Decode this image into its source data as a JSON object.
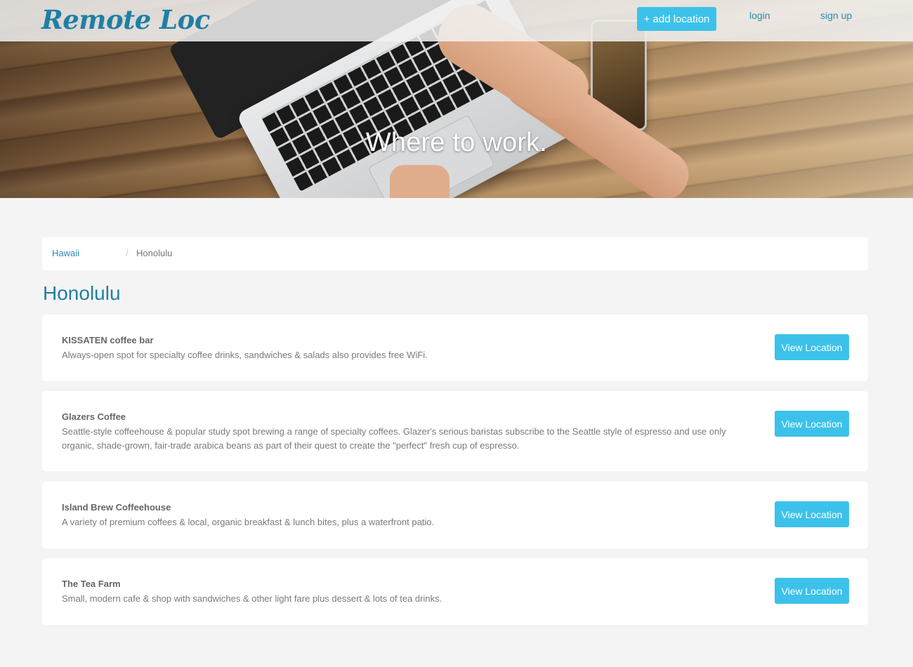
{
  "header": {
    "brand": "Remote Loc",
    "add_location_label": "+ add location",
    "login_label": "login",
    "signup_label": "sign up"
  },
  "hero": {
    "tagline": "Where to work."
  },
  "breadcrumb": {
    "parent": "Hawaii",
    "separator": "/",
    "current": "Honolulu"
  },
  "page": {
    "title": "Honolulu"
  },
  "locations": [
    {
      "name": "KISSATEN coffee bar",
      "description": "Always-open spot for specialty coffee drinks, sandwiches & salads also provides free WiFi.",
      "button_label": "View Location"
    },
    {
      "name": "Glazers Coffee",
      "description": "Seattle-style coffeehouse & popular study spot brewing a range of specialty coffees. Glazer's serious baristas subscribe to the Seattle style of espresso and use only organic, shade-grown, fair-trade arabica beans as part of their quest to create the \"perfect\" fresh cup of espresso.",
      "button_label": "View Location"
    },
    {
      "name": "Island Brew Coffeehouse",
      "description": "A variety of premium coffees & local, organic breakfast & lunch bites, plus a waterfront patio.",
      "button_label": "View Location"
    },
    {
      "name": "The Tea Farm",
      "description": "Small, modern cafe & shop with sandwiches & other light fare plus dessert & lots of tea drinks.",
      "button_label": "View Location"
    }
  ],
  "colors": {
    "accent": "#3cc2ea",
    "brand": "#1f7fa6",
    "link": "#2a8bb5",
    "background": "#f4f4f4"
  },
  "icons": {
    "hero_image": "laptop-on-wooden-table-image"
  }
}
